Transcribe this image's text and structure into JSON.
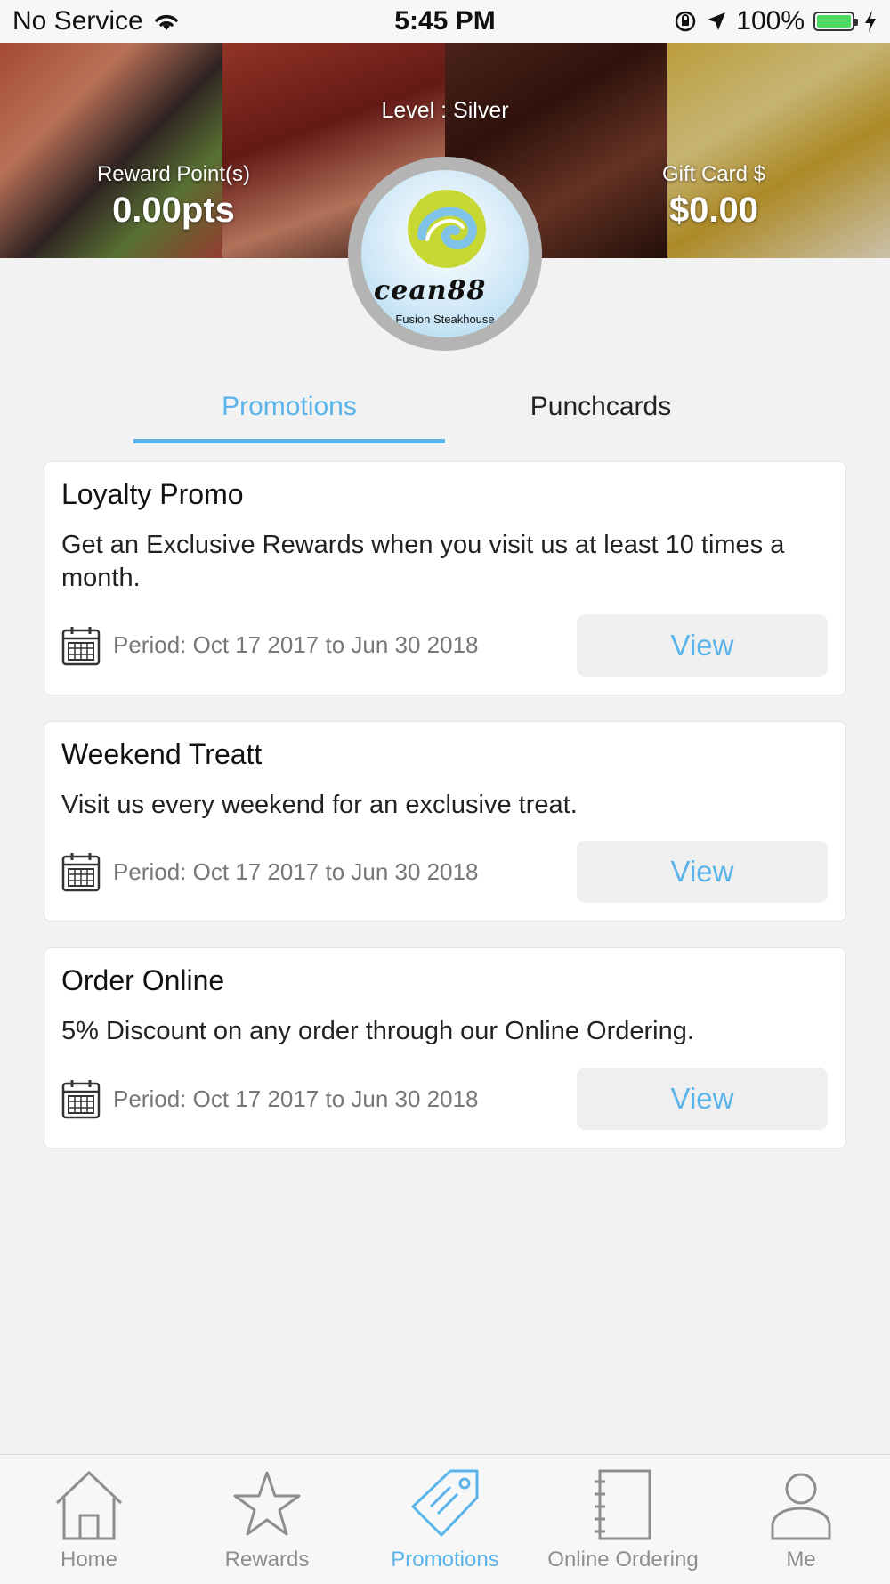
{
  "status_bar": {
    "carrier": "No Service",
    "time": "5:45 PM",
    "battery": "100%"
  },
  "header": {
    "level": "Level : Silver",
    "reward_points_label": "Reward Point(s)",
    "reward_points_value": "0.00pts",
    "gift_card_label": "Gift Card $",
    "gift_card_value": "$0.00",
    "logo_text": "cean88",
    "logo_subtitle": "Fusion Steakhouse"
  },
  "tabs": [
    {
      "label": "Promotions",
      "active": true
    },
    {
      "label": "Punchcards",
      "active": false
    }
  ],
  "promotions": [
    {
      "title": "Loyalty Promo",
      "description": "Get an Exclusive Rewards when you visit us at least 10 times a month.",
      "period": "Period: Oct 17 2017 to Jun 30 2018",
      "button": "View"
    },
    {
      "title": "Weekend Treatt",
      "description": "Visit us every weekend for an exclusive treat.",
      "period": "Period: Oct 17 2017 to Jun 30 2018",
      "button": "View"
    },
    {
      "title": "Order Online",
      "description": "5% Discount on any order through our Online Ordering.",
      "period": "Period: Oct 17 2017 to Jun 30 2018",
      "button": "View"
    }
  ],
  "tab_bar": [
    {
      "label": "Home",
      "icon": "home-icon"
    },
    {
      "label": "Rewards",
      "icon": "star-icon"
    },
    {
      "label": "Promotions",
      "icon": "tag-icon",
      "active": true
    },
    {
      "label": "Online Ordering",
      "icon": "notebook-icon"
    },
    {
      "label": "Me",
      "icon": "person-icon"
    }
  ],
  "colors": {
    "accent": "#5ab4ea",
    "background": "#f2f2f2",
    "battery": "#4cd964"
  }
}
